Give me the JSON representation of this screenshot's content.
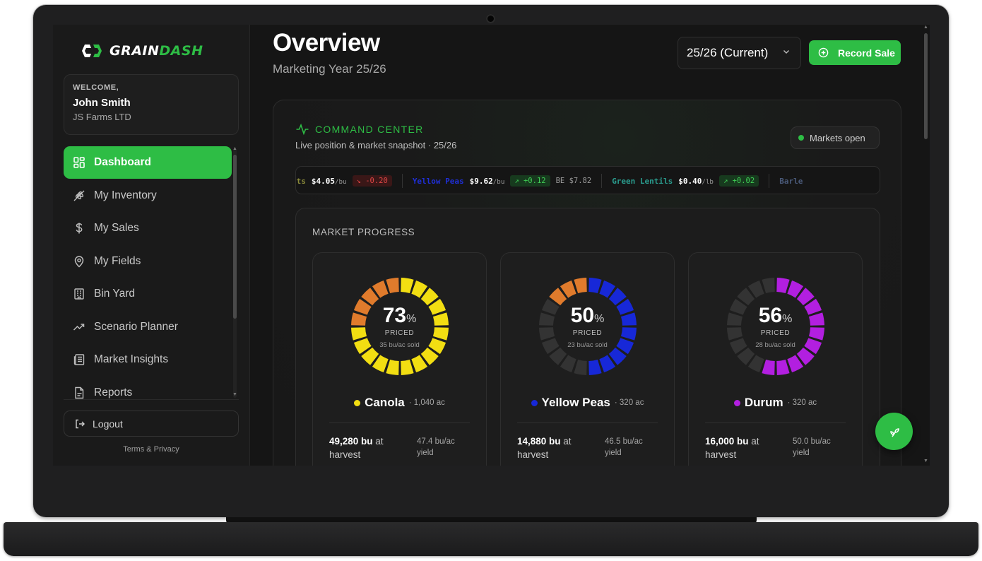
{
  "brand": {
    "logo_left": "GRAIN",
    "logo_right": "DASH",
    "accent": "#2ebd45"
  },
  "welcome": {
    "label": "WELCOME,",
    "name": "John Smith",
    "farm": "JS Farms LTD"
  },
  "sidebar": {
    "items": [
      {
        "label": "Dashboard",
        "icon": "dashboard-icon",
        "active": true
      },
      {
        "label": "My Inventory",
        "icon": "wheat-icon"
      },
      {
        "label": "My Sales",
        "icon": "dollar-icon"
      },
      {
        "label": "My Fields",
        "icon": "map-pin-icon"
      },
      {
        "label": "Bin Yard",
        "icon": "building-icon"
      },
      {
        "label": "Scenario Planner",
        "icon": "trend-icon"
      },
      {
        "label": "Market Insights",
        "icon": "newspaper-icon"
      },
      {
        "label": "Reports",
        "icon": "file-icon"
      }
    ],
    "logout": "Logout",
    "terms": "Terms & Privacy"
  },
  "header": {
    "title": "Overview",
    "subtitle": "Marketing Year 25/26",
    "year_select": "25/26 (Current)",
    "record_sale": "Record Sale"
  },
  "command_center": {
    "title": "COMMAND CENTER",
    "subtitle": "Live position & market snapshot · 25/26",
    "markets_status": "Markets open"
  },
  "ticker": [
    {
      "name": "Oats",
      "name_visible": "ats",
      "price": "$4.05",
      "unit": "/bu",
      "change": "↘ -0.20",
      "dir": "down",
      "name_color": "#8a8a3a"
    },
    {
      "name": "Yellow Peas",
      "price": "$9.62",
      "unit": "/bu",
      "change": "↗ +0.12",
      "dir": "up",
      "be": "BE $7.82",
      "name_color": "#1f2fd6"
    },
    {
      "name": "Green Lentils",
      "price": "$0.40",
      "unit": "/lb",
      "change": "↗ +0.02",
      "dir": "up",
      "name_color": "#2a9d8f"
    },
    {
      "name": "Barley",
      "name_visible": "Barle",
      "name_color": "#4a5a7a"
    }
  ],
  "market_progress": {
    "title": "MARKET PROGRESS",
    "crops": [
      {
        "name": "Canola",
        "acres": "· 1,040 ac",
        "pct": "73",
        "pct_unit": "%",
        "priced": "PRICED",
        "sold": "35 bu/ac sold",
        "harvest_bu": "49,280 bu",
        "harvest_rest": " at harvest",
        "yield": "47.4 bu/ac yield",
        "color": "#f2de12",
        "secondary": "#e07b2c",
        "percent": 73,
        "secondary_percent": 27
      },
      {
        "name": "Yellow Peas",
        "acres": "· 320 ac",
        "pct": "50",
        "pct_unit": "%",
        "priced": "PRICED",
        "sold": "23 bu/ac sold",
        "harvest_bu": "14,880 bu",
        "harvest_rest": " at harvest",
        "yield": "46.5 bu/ac yield",
        "color": "#1728d8",
        "secondary": "#e07b2c",
        "percent": 50,
        "secondary_percent": 15
      },
      {
        "name": "Durum",
        "acres": "· 320 ac",
        "pct": "56",
        "pct_unit": "%",
        "priced": "PRICED",
        "sold": "28 bu/ac sold",
        "harvest_bu": "16,000 bu",
        "harvest_rest": " at harvest",
        "yield": "50.0 bu/ac yield",
        "color": "#b21fe0",
        "secondary": "#333333",
        "percent": 56,
        "secondary_percent": 0
      }
    ]
  }
}
